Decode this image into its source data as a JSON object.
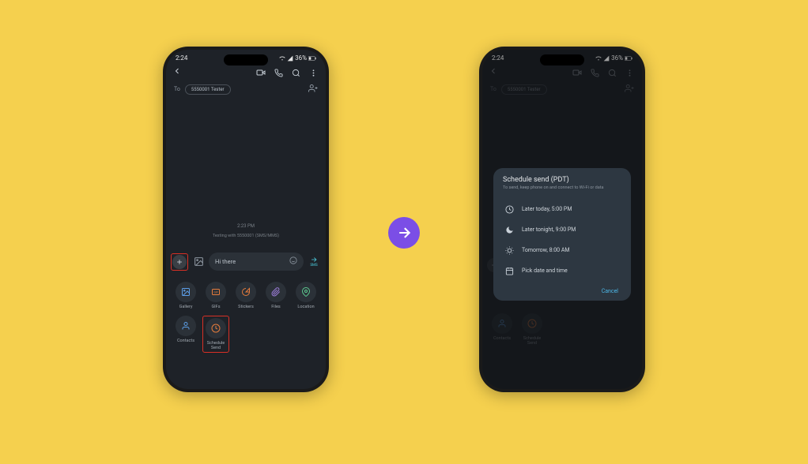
{
  "status": {
    "time": "2:24",
    "battery_pct": "36%"
  },
  "header": {
    "to_label": "To",
    "contact": "5550001 Tester"
  },
  "conversation": {
    "timestamp": "2:23 PM",
    "texting_with": "Texting with 5550001 (SMS/MMS)"
  },
  "compose": {
    "text": "Hi there",
    "send_label": "SMS"
  },
  "attach": {
    "row1": [
      {
        "label": "Gallery",
        "colorcls": "icon-blue"
      },
      {
        "label": "GIFs",
        "colorcls": "icon-orange"
      },
      {
        "label": "Stickers",
        "colorcls": "icon-orange"
      },
      {
        "label": "Files",
        "colorcls": "icon-purple"
      },
      {
        "label": "Location",
        "colorcls": "icon-green"
      }
    ],
    "row2": [
      {
        "label": "Contacts",
        "colorcls": "icon-blue"
      },
      {
        "label": "Schedule Send",
        "colorcls": "icon-orange"
      }
    ]
  },
  "dialog": {
    "title": "Schedule send (PDT)",
    "subtitle": "To send, keep phone on and connect to Wi-Fi or data",
    "options": [
      {
        "label": "Later today, 5:00 PM"
      },
      {
        "label": "Later tonight, 9:00 PM"
      },
      {
        "label": "Tomorrow, 8:00 AM"
      },
      {
        "label": "Pick date and time"
      }
    ],
    "cancel": "Cancel"
  }
}
